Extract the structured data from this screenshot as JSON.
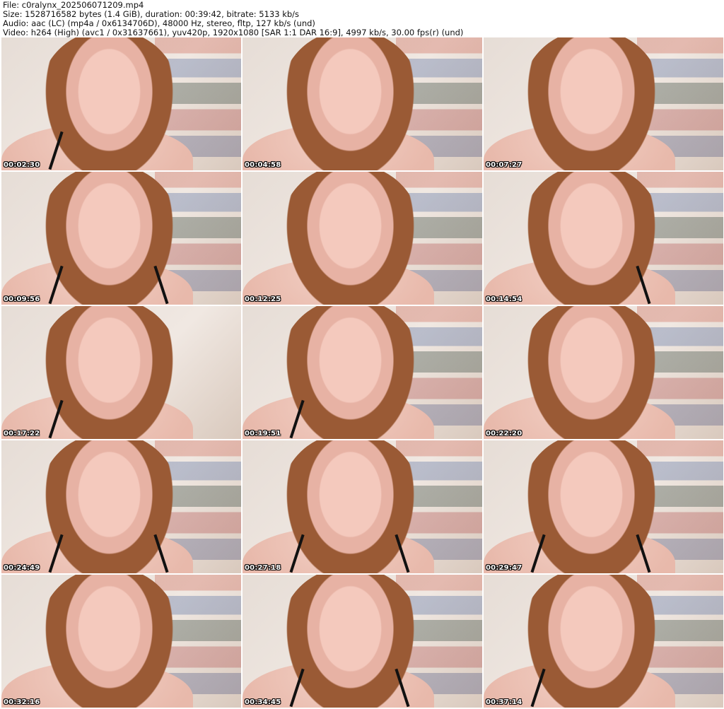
{
  "header": {
    "file": "File: c0ralynx_202506071209.mp4",
    "size": "Size: 1528716582 bytes (1.4 GiB), duration: 00:39:42, bitrate: 5133 kb/s",
    "audio": "Audio: aac (LC) (mp4a / 0x6134706D), 48000 Hz, stereo, fltp, 127 kb/s (und)",
    "video": "Video: h264 (High) (avc1 / 0x31637661), yuv420p, 1920x1080 [SAR 1:1 DAR 16:9], 4997 kb/s, 30.00 fps(r) (und)"
  },
  "thumbnails": [
    {
      "timestamp": "00:02:30"
    },
    {
      "timestamp": "00:04:58"
    },
    {
      "timestamp": "00:07:27"
    },
    {
      "timestamp": "00:09:56"
    },
    {
      "timestamp": "00:12:25"
    },
    {
      "timestamp": "00:14:54"
    },
    {
      "timestamp": "00:17:22"
    },
    {
      "timestamp": "00:19:51"
    },
    {
      "timestamp": "00:22:20"
    },
    {
      "timestamp": "00:24:49"
    },
    {
      "timestamp": "00:27:18"
    },
    {
      "timestamp": "00:29:47"
    },
    {
      "timestamp": "00:32:16"
    },
    {
      "timestamp": "00:34:45"
    },
    {
      "timestamp": "00:37:14"
    }
  ]
}
